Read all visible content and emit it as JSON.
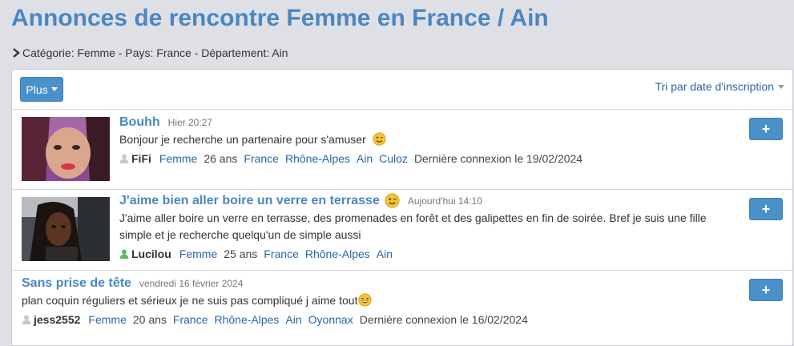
{
  "page": {
    "title": "Annonces de rencontre Femme en France / Ain"
  },
  "breadcrumb": {
    "text": "Catégorie: Femme - Pays: France - Département: Ain"
  },
  "toolbar": {
    "plus_label": "Plus",
    "sort_label": "Tri par date d'inscription"
  },
  "ads": [
    {
      "title": "Bouhh",
      "date": "Hier 20:27",
      "description": "Bonjour je recherche un partenaire pour s'amuser",
      "user": "FiFi",
      "gender": "Femme",
      "age": "26 ans",
      "country": "France",
      "region": "Rhône-Alpes",
      "department": "Ain",
      "city": "Culoz",
      "last_login": "Dernière connexion le 19/02/2024",
      "add_label": "+"
    },
    {
      "title": "J'aime bien aller boire un verre en terrasse",
      "date": "Aujourd'hui 14:10",
      "description": "J'aime aller boire un verre en terrasse, des promenades en forêt et des galipettes en fin de soirée. Bref je suis une fille simple et je recherche quelqu'un de simple aussi",
      "user": "Lucilou",
      "gender": "Femme",
      "age": "25 ans",
      "country": "France",
      "region": "Rhône-Alpes",
      "department": "Ain",
      "add_label": "+"
    },
    {
      "title": "Sans prise de tête",
      "date": "vendredi 16 février 2024",
      "description": "plan coquin réguliers et sérieux je ne suis pas compliqué j aime tout",
      "user": "jess2552",
      "gender": "Femme",
      "age": "20 ans",
      "country": "France",
      "region": "Rhône-Alpes",
      "department": "Ain",
      "city": "Oyonnax",
      "last_login": "Dernière connexion le 16/02/2024",
      "add_label": "+"
    }
  ],
  "colors": {
    "accent": "#4a87c2",
    "link": "#2a65a8",
    "button": "#4a90c9",
    "online": "#5cb85c",
    "offline": "#c8c8c8"
  },
  "icons": [
    "chevron-right-icon",
    "caret-down-icon",
    "user-icon",
    "wink-emoji-icon",
    "laugh-emoji-icon"
  ]
}
